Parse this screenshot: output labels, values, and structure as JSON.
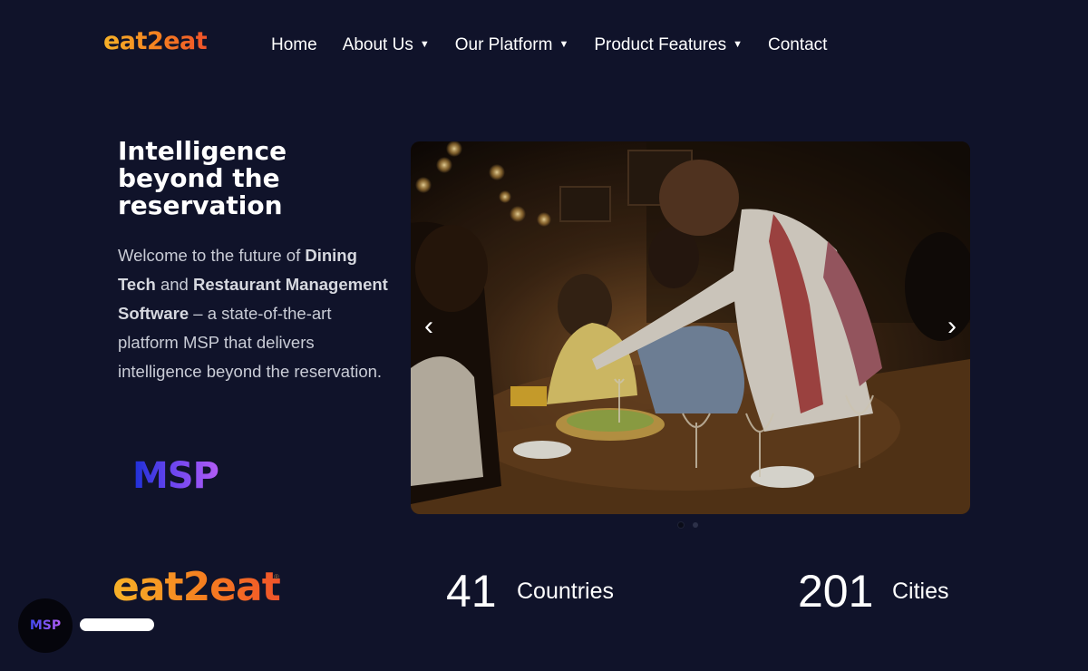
{
  "header": {
    "logo_text": "eat2eat",
    "nav": [
      {
        "label": "Home",
        "has_dropdown": false
      },
      {
        "label": "About Us",
        "has_dropdown": true
      },
      {
        "label": "Our Platform",
        "has_dropdown": true
      },
      {
        "label": "Product Features",
        "has_dropdown": true
      },
      {
        "label": "Contact",
        "has_dropdown": false
      }
    ],
    "dropdown_icon": "▼"
  },
  "hero": {
    "title": "Intelligence beyond the reservation",
    "intro_1": "Welcome to the future of ",
    "bold_1": "Dining Tech",
    "intro_2": " and ",
    "bold_2": "Restaurant Management Software",
    "intro_3": " – a state-of-the-art platform MSP that delivers intelligence beyond the reservation.",
    "msp_logo_text": "MSP"
  },
  "carousel": {
    "prev_icon": "‹",
    "next_icon": "›",
    "slide_count": 2,
    "active_slide": 1
  },
  "stats": {
    "brand_logo_text": "eat2eat",
    "registered_mark": "®",
    "items": [
      {
        "value": "41",
        "label": "Countries"
      },
      {
        "value": "201",
        "label": "Cities"
      }
    ]
  },
  "badge": {
    "text": "MSP"
  },
  "colors": {
    "background": "#10132a",
    "brand_orange": "#f57e20",
    "brand_yellow": "#f7b228",
    "msp_purple": "#8a50f2",
    "msp_blue": "#1b2fd6"
  }
}
